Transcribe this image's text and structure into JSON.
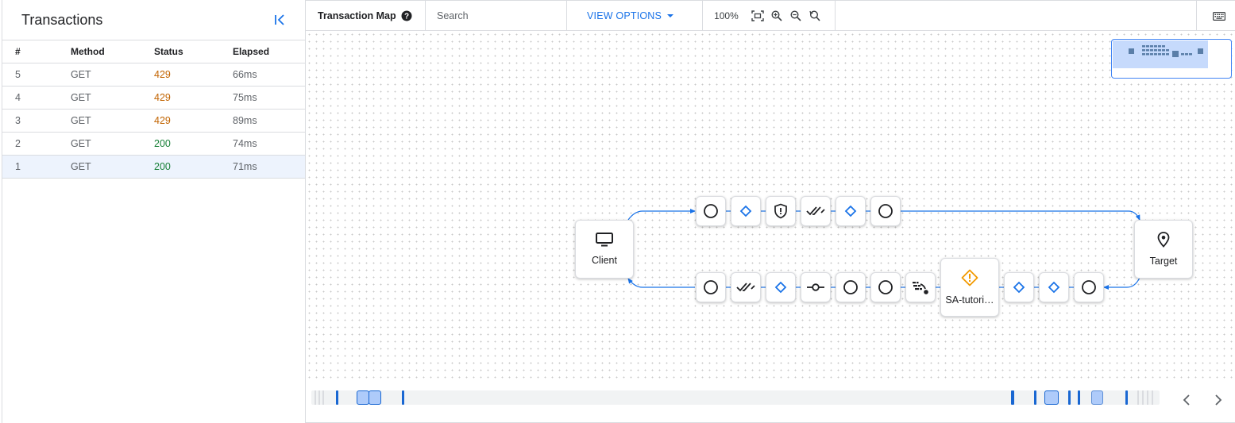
{
  "panel": {
    "title": "Transactions",
    "columns": [
      "#",
      "Method",
      "Status",
      "Elapsed"
    ],
    "rows": [
      {
        "num": "5",
        "method": "GET",
        "status": "429",
        "elapsed": "66ms"
      },
      {
        "num": "4",
        "method": "GET",
        "status": "429",
        "elapsed": "75ms"
      },
      {
        "num": "3",
        "method": "GET",
        "status": "429",
        "elapsed": "89ms"
      },
      {
        "num": "2",
        "method": "GET",
        "status": "200",
        "elapsed": "74ms"
      },
      {
        "num": "1",
        "method": "GET",
        "status": "200",
        "elapsed": "71ms"
      }
    ],
    "selected_row": "1"
  },
  "toolbar": {
    "map_title": "Transaction Map",
    "search_placeholder": "Search",
    "view_options_label": "VIEW OPTIONS",
    "zoom_level": "100%"
  },
  "map": {
    "client_label": "Client",
    "target_label": "Target",
    "policy_label": "SA-tutori…",
    "request_steps": [
      "circle-icon",
      "diamond-icon",
      "shield-icon",
      "double-check-icon",
      "diamond-icon",
      "circle-icon"
    ],
    "response_steps": [
      "circle-icon",
      "double-check-icon",
      "diamond-icon",
      "commit-icon",
      "circle-icon",
      "circle-icon",
      "signal-icon"
    ],
    "response_steps_after": [
      "diamond-icon",
      "diamond-icon",
      "circle-icon"
    ]
  },
  "colors": {
    "accent": "#1a73e8",
    "status_429": "#c26401",
    "status_200": "#188038",
    "warning": "#f29900"
  }
}
